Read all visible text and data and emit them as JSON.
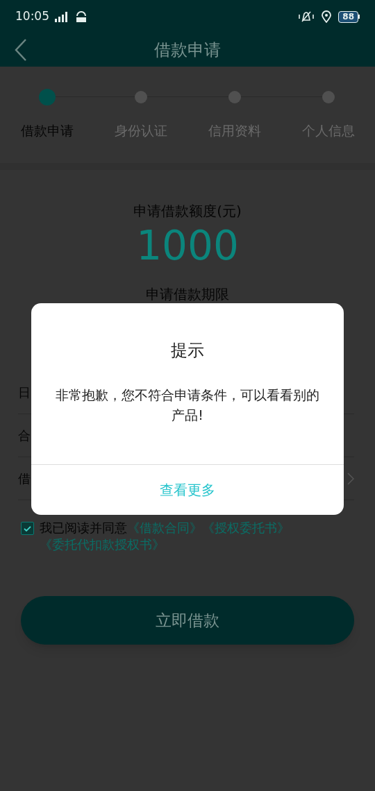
{
  "status_bar": {
    "time": "10:05",
    "battery": "88"
  },
  "header": {
    "title": "借款申请"
  },
  "steps": [
    {
      "label": "借款申请",
      "selected": true
    },
    {
      "label": "身份认证",
      "selected": false
    },
    {
      "label": "信用资料",
      "selected": false
    },
    {
      "label": "个人信息",
      "selected": false
    }
  ],
  "amount": {
    "label": "申请借款额度(元)",
    "value": "1000"
  },
  "term": {
    "label": "申请借款期限"
  },
  "rows": [
    {
      "label": "日",
      "has_chevron": false
    },
    {
      "label": "合",
      "has_chevron": false
    },
    {
      "label": "借",
      "has_chevron": true
    }
  ],
  "agreement": {
    "checked": true,
    "text": "我已阅读并同意",
    "links": [
      "《借款合同》",
      "《授权委托书》",
      "《委托代扣款授权书》"
    ]
  },
  "submit_button": "立即借款",
  "dialog": {
    "title": "提示",
    "message": "非常抱歉，您不符合申请条件，可以看看别的产品!",
    "action": "查看更多"
  }
}
